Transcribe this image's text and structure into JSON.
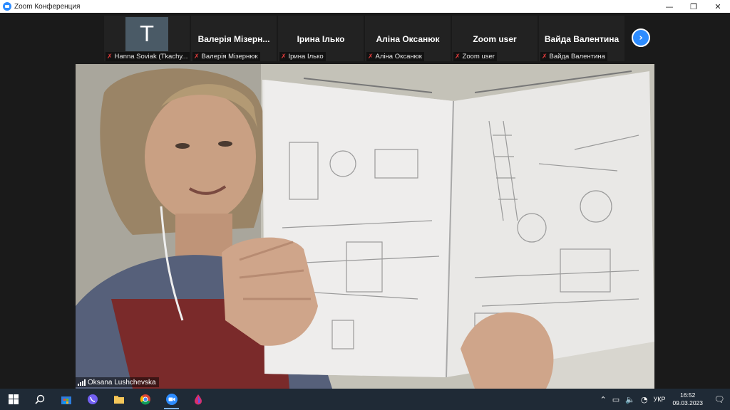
{
  "window": {
    "title": "Zoom Конференция",
    "minimize": "—",
    "restore": "❐",
    "close": "✕"
  },
  "participants": [
    {
      "name": "",
      "avatar_letter": "T",
      "label": "Hanna Soviak (Tkachy..."
    },
    {
      "name": "Валерія Мізерн...",
      "label": "Валерія Мізернюк"
    },
    {
      "name": "Ірина Ілько",
      "label": "Ірина Ілько"
    },
    {
      "name": "Аліна Оксанюк",
      "label": "Аліна Оксанюк"
    },
    {
      "name": "Zoom user",
      "label": "Zoom user"
    },
    {
      "name": "Вайда Валентина",
      "label": "Вайда Валентина"
    }
  ],
  "muted_icon": "mic-muted-icon",
  "next_page_icon": "chevron-right-icon",
  "speaker": {
    "name": "Oksana Lushchevska"
  },
  "taskbar": {
    "apps": [
      "windows-start",
      "search",
      "store",
      "viber",
      "file-explorer",
      "chrome",
      "zoom",
      "paint"
    ],
    "tray": {
      "language": "УКР",
      "time": "16:52",
      "date": "09.03.2023"
    }
  },
  "colors": {
    "zoom_blue": "#2d8cff",
    "muted_red": "#e03b3b",
    "taskbar": "#1f2a36"
  }
}
